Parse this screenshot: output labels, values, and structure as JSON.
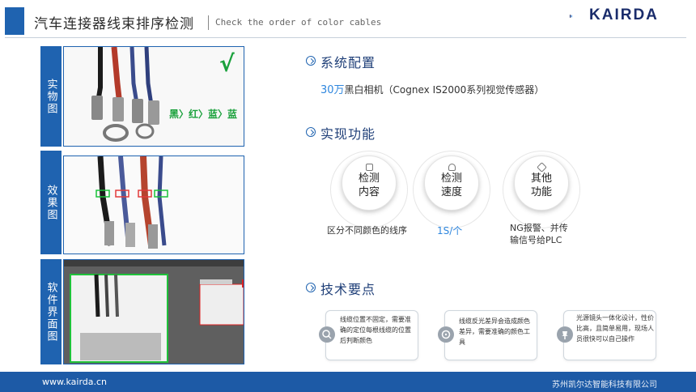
{
  "header": {
    "title": "汽车连接器线束排序检测",
    "subtitle": "Check the order of color cables",
    "logo_text": "KAIRDA"
  },
  "left_panel": {
    "tabs": [
      {
        "label": "实物图"
      },
      {
        "label": "效果图"
      },
      {
        "label": "软件界面图"
      }
    ],
    "real_photo": {
      "check_mark": "√",
      "order_text": "黑〉红〉蓝〉蓝"
    }
  },
  "sections": {
    "config": {
      "title": "系统配置",
      "value_highlight": "30万",
      "value_rest": "黑白相机（Cognex IS2000系列视觉传感器）"
    },
    "function": {
      "title": "实现功能",
      "items": [
        {
          "line1": "检测",
          "line2": "内容",
          "desc": "区分不同颜色的线序"
        },
        {
          "line1": "检测",
          "line2": "速度",
          "desc": "1S/个"
        },
        {
          "line1": "其他",
          "line2": "功能",
          "desc": "NG报警、并传\n输信号给PLC"
        }
      ]
    },
    "tech": {
      "title": "技术要点",
      "cards": [
        {
          "icon": "search-icon",
          "text": "线缆位置不固定，需要准确的定位每根线缆的位置后判断颜色"
        },
        {
          "icon": "target-icon",
          "text": "线缆反光差异会造成颜色差异，需要准确的颜色工具"
        },
        {
          "icon": "pin-icon",
          "text": "光源镜头一体化设计，性价比高，且简单易用，现场人员很快可以自己操作"
        }
      ]
    }
  },
  "footer": {
    "website": "www.kairda.cn",
    "company": "苏州凯尔达智能科技有限公司"
  },
  "colors": {
    "accent": "#1f63b0",
    "highlight": "#2e86de",
    "check_green": "#1aa13c"
  }
}
